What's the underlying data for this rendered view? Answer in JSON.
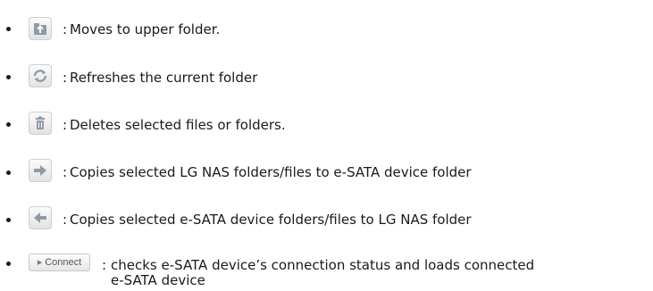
{
  "items": [
    {
      "icon": "upper-folder-icon",
      "text": "Moves to upper folder."
    },
    {
      "icon": "refresh-icon",
      "text": "Refreshes the current folder"
    },
    {
      "icon": "trash-icon",
      "text": "Deletes selected files or folders."
    },
    {
      "icon": "arrow-right-icon",
      "text": "Copies selected LG NAS folders/files to e-SATA device folder"
    },
    {
      "icon": "arrow-left-icon",
      "text": "Copies selected e-SATA device folders/files to LG NAS folder"
    },
    {
      "icon": "connect-button",
      "button_label": "Connect",
      "text_line1": "checks e-SATA device’s connection status and loads connected",
      "text_line2": "e-SATA device"
    }
  ],
  "separator": ":"
}
